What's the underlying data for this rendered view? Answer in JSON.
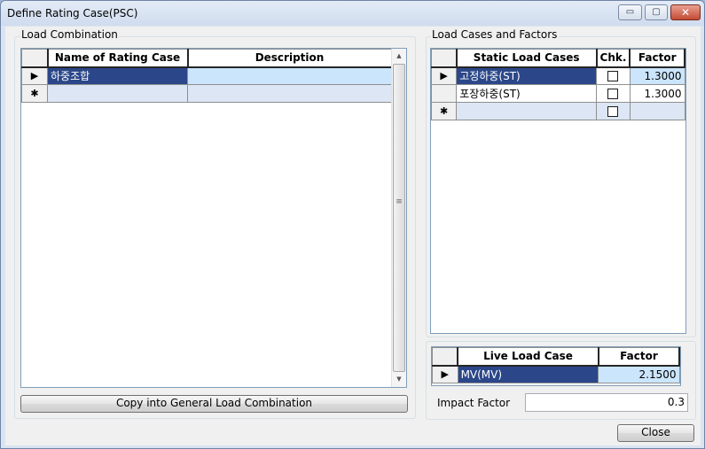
{
  "window": {
    "title": "Define Rating Case(PSC)",
    "min_glyph": "▭",
    "max_glyph": "▢",
    "close_glyph": "✕"
  },
  "load_combination": {
    "group_label": "Load Combination",
    "headers": [
      "Name of Rating Case",
      "Description"
    ],
    "rows": [
      {
        "marker": "▶",
        "name": "하중조합",
        "description": ""
      },
      {
        "marker": "✱",
        "name": "",
        "description": ""
      }
    ],
    "scroll_grip": "≡",
    "scroll_up": "▲",
    "scroll_down": "▼",
    "copy_button": "Copy into General Load Combination"
  },
  "load_cases": {
    "group_label": "Load Cases and Factors",
    "headers": [
      "Static Load Cases",
      "Chk.",
      "Factor"
    ],
    "rows": [
      {
        "marker": "▶",
        "name": "고정하중(ST)",
        "checked": false,
        "factor": "1.3000"
      },
      {
        "marker": "",
        "name": "포장하중(ST)",
        "checked": false,
        "factor": "1.3000"
      },
      {
        "marker": "✱",
        "name": "",
        "checked": false,
        "factor": ""
      }
    ]
  },
  "live_load": {
    "headers": [
      "Live Load Case",
      "Factor"
    ],
    "rows": [
      {
        "marker": "▶",
        "name": "MV(MV)",
        "factor": "2.1500"
      }
    ],
    "impact_label": "Impact Factor",
    "impact_value": "0.3"
  },
  "close_button": "Close"
}
